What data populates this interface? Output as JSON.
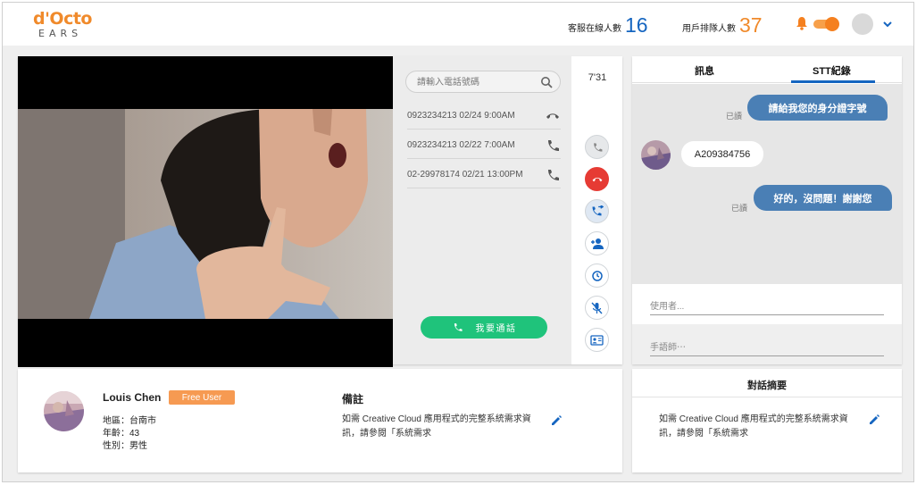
{
  "header": {
    "logo_main": "d'Octo",
    "logo_sub": "EARS",
    "agents_online_label": "客服在線人數",
    "agents_online_value": "16",
    "queue_label": "用戶排隊人數",
    "queue_value": "37",
    "accent_color": "#f08a2b",
    "value_color": "#1565c0",
    "queue_color": "#f08a2b"
  },
  "call_panel": {
    "search_placeholder": "請輸入電話號碼",
    "calls": [
      {
        "text": "0923234213  02/24  9:00AM",
        "icon": "hangup-icon"
      },
      {
        "text": "0923234213  02/22  7:00AM",
        "icon": "phone-icon"
      },
      {
        "text": "02-29978174  02/21  13:00PM",
        "icon": "phone-icon"
      }
    ],
    "cta_label": "我要通話"
  },
  "controls": {
    "timer": "7'31",
    "buttons": [
      "phone-icon",
      "hangup-icon",
      "transfer-call-icon",
      "add-user-icon",
      "history-icon",
      "mic-off-icon",
      "id-card-icon"
    ]
  },
  "chat": {
    "tabs": [
      {
        "label": "訊息"
      },
      {
        "label": "STT紀錄",
        "active": true
      }
    ],
    "messages": [
      {
        "from": "agent",
        "text": "請給我您的身分證字號",
        "status": "已讀"
      },
      {
        "from": "user",
        "text": "A209384756"
      },
      {
        "from": "agent",
        "text": "好的，沒問題！謝謝您",
        "status": "已讀"
      }
    ],
    "user_field_placeholder": "使用者...",
    "interpreter_field_placeholder": "手語師⋯"
  },
  "user_info": {
    "name": "Louis Chen",
    "badge": "Free User",
    "region": "地區：台南市",
    "age": "年齡：43",
    "gender": "性別：男性"
  },
  "notes": {
    "title": "備註",
    "text": "如需 Creative Cloud 應用程式的完整系統需求資訊，請參閱「系統需求"
  },
  "summary": {
    "title": "對話摘要",
    "text": "如需 Creative Cloud 應用程式的完整系統需求資訊，請參閱「系統需求"
  }
}
